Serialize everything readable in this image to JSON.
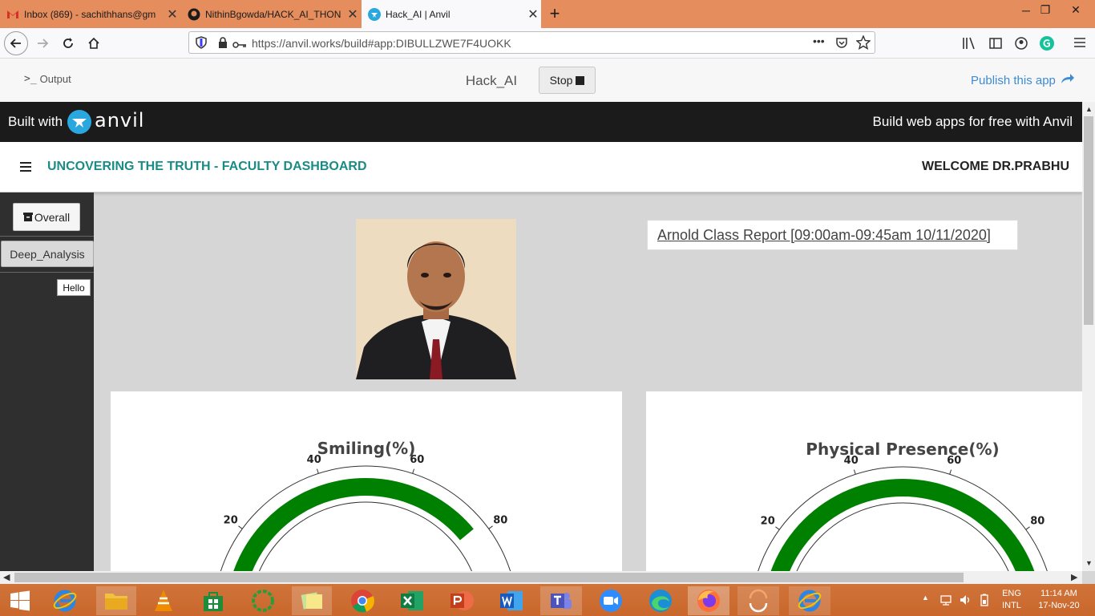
{
  "browser": {
    "tabs": [
      {
        "label": "Inbox (869) - sachithhans@gm"
      },
      {
        "label": "NithinBgowda/HACK_AI_THON"
      },
      {
        "label": "Hack_AI | Anvil"
      }
    ],
    "new_tab": "+",
    "window_controls": {
      "minimize": "─",
      "restore": "❐",
      "close": "✕"
    },
    "url": "https://anvil.works/build#app:DIBULLZWE7F4UOKK",
    "url_host": "anvil.works",
    "page_actions": "•••"
  },
  "ide": {
    "output_label": "Output",
    "app_name": "Hack_AI",
    "stop_label": "Stop",
    "publish_label": "Publish this app"
  },
  "anvil_bar": {
    "built_with": "Built with",
    "brand": "anvil",
    "tagline": "Build web apps for free with Anvil"
  },
  "app": {
    "title": "UNCOVERING THE TRUTH - FACULTY DASHBOARD",
    "welcome": "WELCOME DR.PRABHU",
    "sidebar": {
      "overall_label": "Overall",
      "deep_analysis_label": "Deep_Analysis",
      "hello_label": "Hello"
    },
    "report_link": "Arnold Class Report [09:00am-09:45am 10/11/2020]",
    "gauges": [
      {
        "title": "Smiling(%)",
        "ticks": [
          "20",
          "40",
          "60",
          "80"
        ],
        "value": 78,
        "range": [
          0,
          100
        ]
      },
      {
        "title": "Physical Presence(%)",
        "ticks": [
          "20",
          "40",
          "60",
          "80"
        ],
        "value": 100,
        "range": [
          0,
          100
        ]
      }
    ],
    "colors": {
      "accent": "#1a8c85",
      "gauge_fill": "#008000",
      "dark": "#1b1b1b"
    }
  },
  "taskbar": {
    "language": "ENG",
    "layout": "INTL",
    "time": "11:14 AM",
    "date": "17-Nov-20",
    "tray_arrow": "▲"
  }
}
